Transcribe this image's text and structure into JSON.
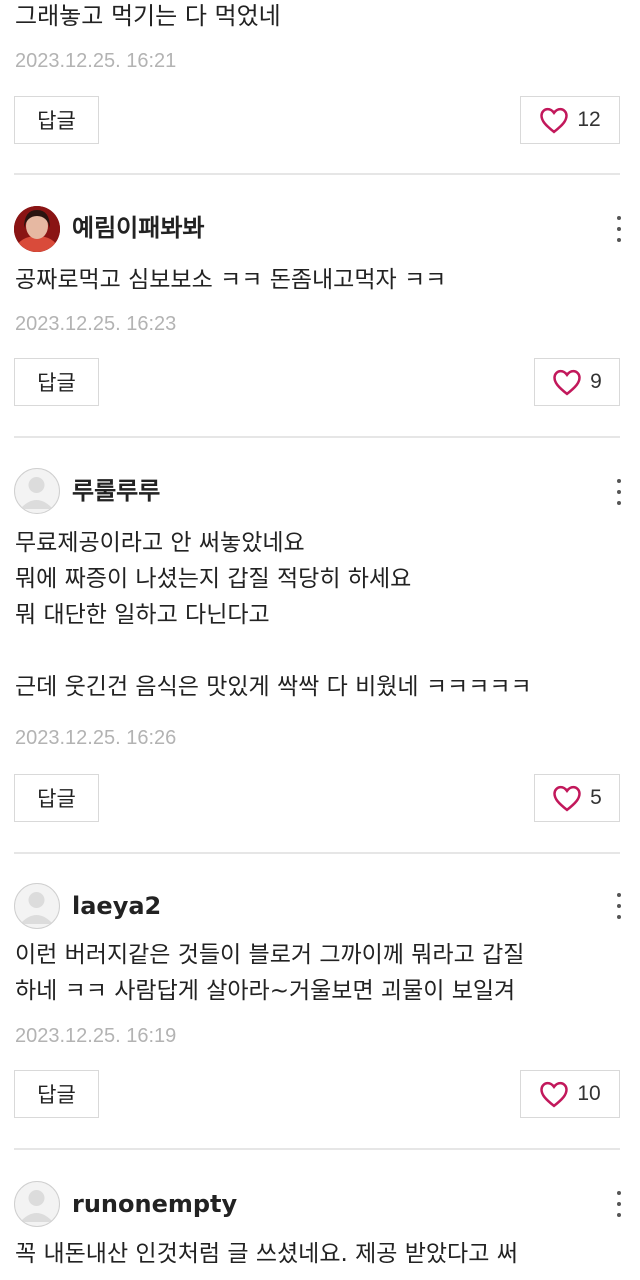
{
  "comments": [
    {
      "body_lines": [
        "그래놓고 먹기는 다 먹었네"
      ],
      "time": "2023.12.25. 16:21",
      "reply_label": "답글",
      "likes": "12"
    },
    {
      "user": "예림이패봐봐",
      "avatar": "photo",
      "body_lines": [
        "공짜로먹고 심보보소 ㅋㅋ 돈좀내고먹자 ㅋㅋ"
      ],
      "time": "2023.12.25. 16:23",
      "reply_label": "답글",
      "likes": "9"
    },
    {
      "user": "루룰루루",
      "avatar": "default",
      "body_lines": [
        "무료제공이라고 안 써놓았네요",
        "뭐에 짜증이 나셨는지 갑질 적당히 하세요",
        "뭐 대단한 일하고 다닌다고",
        "",
        "근데 웃긴건 음식은 맛있게 싹싹 다 비웠네 ㅋㅋㅋㅋㅋ"
      ],
      "time": "2023.12.25. 16:26",
      "reply_label": "답글",
      "likes": "5"
    },
    {
      "user": "laeya2",
      "avatar": "default",
      "body_lines": [
        "이런 버러지같은 것들이 블로거 그까이께 뭐라고 갑질",
        "하네 ㅋㅋ 사람답게 살아라~거울보면 괴물이 보일겨"
      ],
      "time": "2023.12.25. 16:19",
      "reply_label": "답글",
      "likes": "10"
    },
    {
      "user": "runonempty",
      "avatar": "default",
      "body_lines": [
        "꼭 내돈내산 인것처럼 글 쓰셨네요. 제공 받았다고 써"
      ]
    }
  ],
  "colors": {
    "heart": "#c2185b",
    "timestamp": "#b3b3b3",
    "border": "#d9d9d9"
  }
}
